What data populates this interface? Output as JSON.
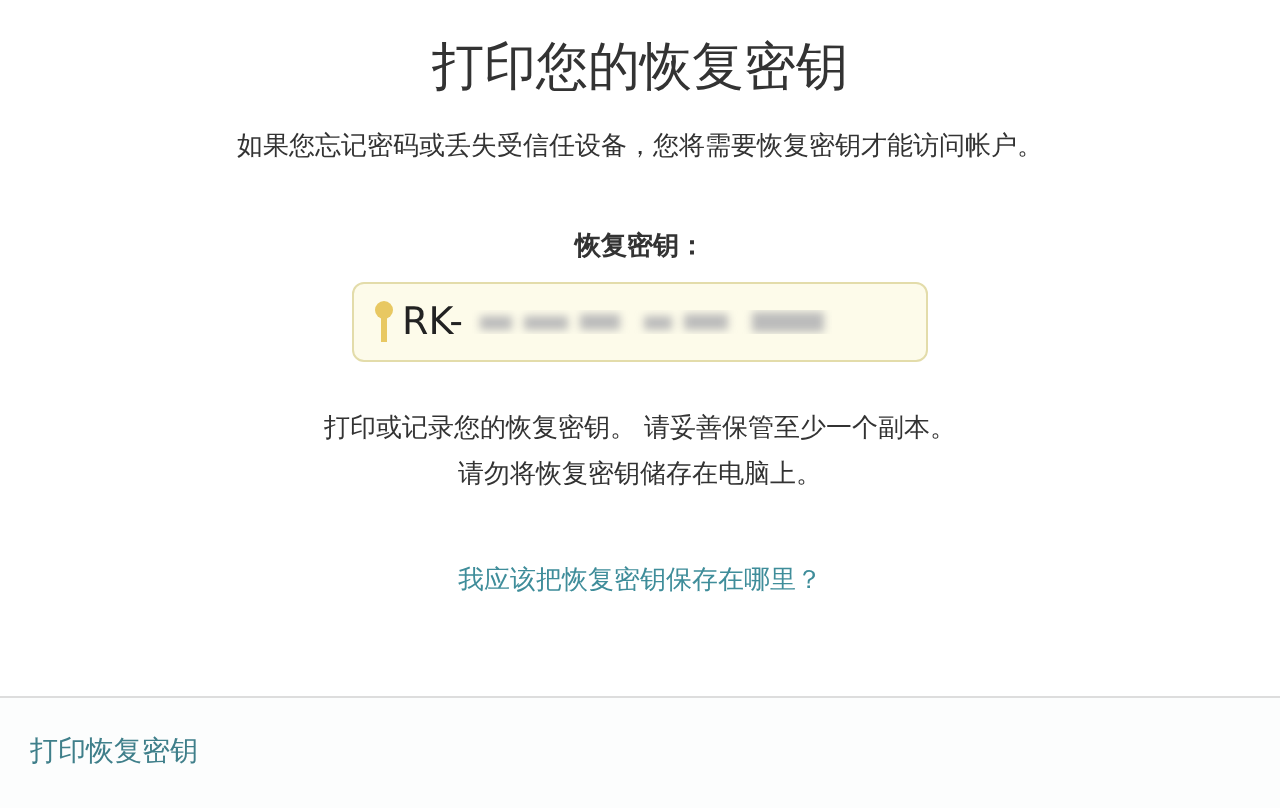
{
  "title": "打印您的恢复密钥",
  "subtitle": "如果您忘记密码或丢失受信任设备，您将需要恢复密钥才能访问帐户。",
  "key_label": "恢复密钥：",
  "key_field": {
    "value": "RK-"
  },
  "instructions": [
    "打印或记录您的恢复密钥。 请妥善保管至少一个副本。",
    "请勿将恢复密钥储存在电脑上。"
  ],
  "help_link": "我应该把恢复密钥保存在哪里？",
  "footer": {
    "link": "打印恢复密钥"
  }
}
